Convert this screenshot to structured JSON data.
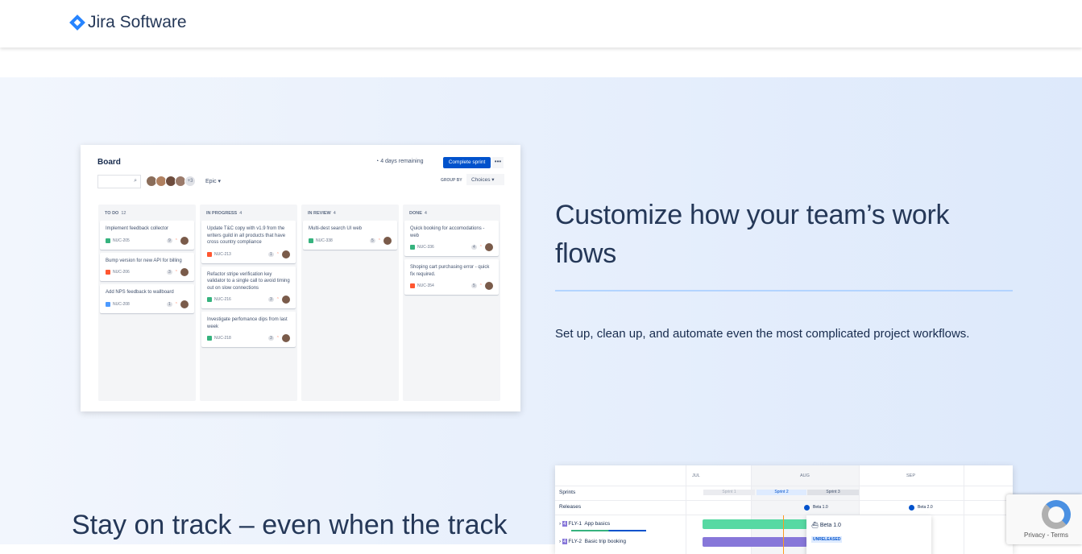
{
  "header": {
    "brand": "Jira Software"
  },
  "section1": {
    "heading": "Customize how your team’s work flows",
    "body": "Set up, clean up, and automate even the most complicated project workflows."
  },
  "section2": {
    "heading": "Stay on track – even when the track"
  },
  "board": {
    "title": "Board",
    "avatars_more": "+3",
    "filter": "Epic ▾",
    "remaining": "4 days remaining",
    "complete_sprint": "Complete sprint",
    "more": "•••",
    "group_by": "GROUP BY",
    "choices": "Choices ▾",
    "columns": [
      {
        "name": "TO DO",
        "count": "12",
        "cards": [
          {
            "title": "Implement feedback collector",
            "key": "NUC-205",
            "points": "9",
            "type": "story"
          },
          {
            "title": "Bump version for new API for billing",
            "key": "NUC-206",
            "points": "3",
            "type": "bug"
          },
          {
            "title": "Add NPS feedback to wallboard",
            "key": "NUC-208",
            "points": "1",
            "type": "task"
          }
        ]
      },
      {
        "name": "IN PROGRESS",
        "count": "4",
        "cards": [
          {
            "title": "Update T&C copy with v1.9 from the writers guild in all products that have cross country compliance",
            "key": "NUC-213",
            "points": "1",
            "type": "bug"
          },
          {
            "title": "Refactor stripe verification key validator to a single call to avoid timing out on slow connections",
            "key": "NUC-216",
            "points": "3",
            "type": "story"
          },
          {
            "title": "Investigate perfomance dips from last week",
            "key": "NUC-218",
            "points": "3",
            "type": "story"
          }
        ]
      },
      {
        "name": "IN REVIEW",
        "count": "4",
        "cards": [
          {
            "title": "Multi-dest search UI web",
            "key": "NUC-338",
            "points": "5",
            "type": "story"
          }
        ]
      },
      {
        "name": "DONE",
        "count": "4",
        "cards": [
          {
            "title": "Quick booking for accomodations - web",
            "key": "NUC-336",
            "points": "4",
            "type": "story"
          },
          {
            "title": "Shoping cart purchasing error - quick fix required.",
            "key": "NUC-354",
            "points": "5",
            "type": "bug"
          }
        ]
      }
    ]
  },
  "timeline": {
    "months": [
      "JUL",
      "AUG",
      "SEP"
    ],
    "rows": [
      "Sprints",
      "Releases"
    ],
    "sprints": [
      "Sprint 1",
      "Sprint 2",
      "Sprint 3"
    ],
    "releases": [
      "Beta 1.0",
      "Beta 2.0"
    ],
    "epics": [
      {
        "key": "FLY-1",
        "name": "App basics",
        "color": "#57d9a3"
      },
      {
        "key": "FLY-2",
        "name": "Basic trip booking",
        "color": "#8777d9"
      }
    ],
    "popover": {
      "title": "Beta 1.0",
      "status": "UNRELEASED"
    }
  },
  "recaptcha": {
    "text": "Privacy - Terms"
  },
  "colors": {
    "story": "#36b37e",
    "bug": "#ff5630",
    "task": "#4c9aff",
    "accent": "#0052cc"
  }
}
